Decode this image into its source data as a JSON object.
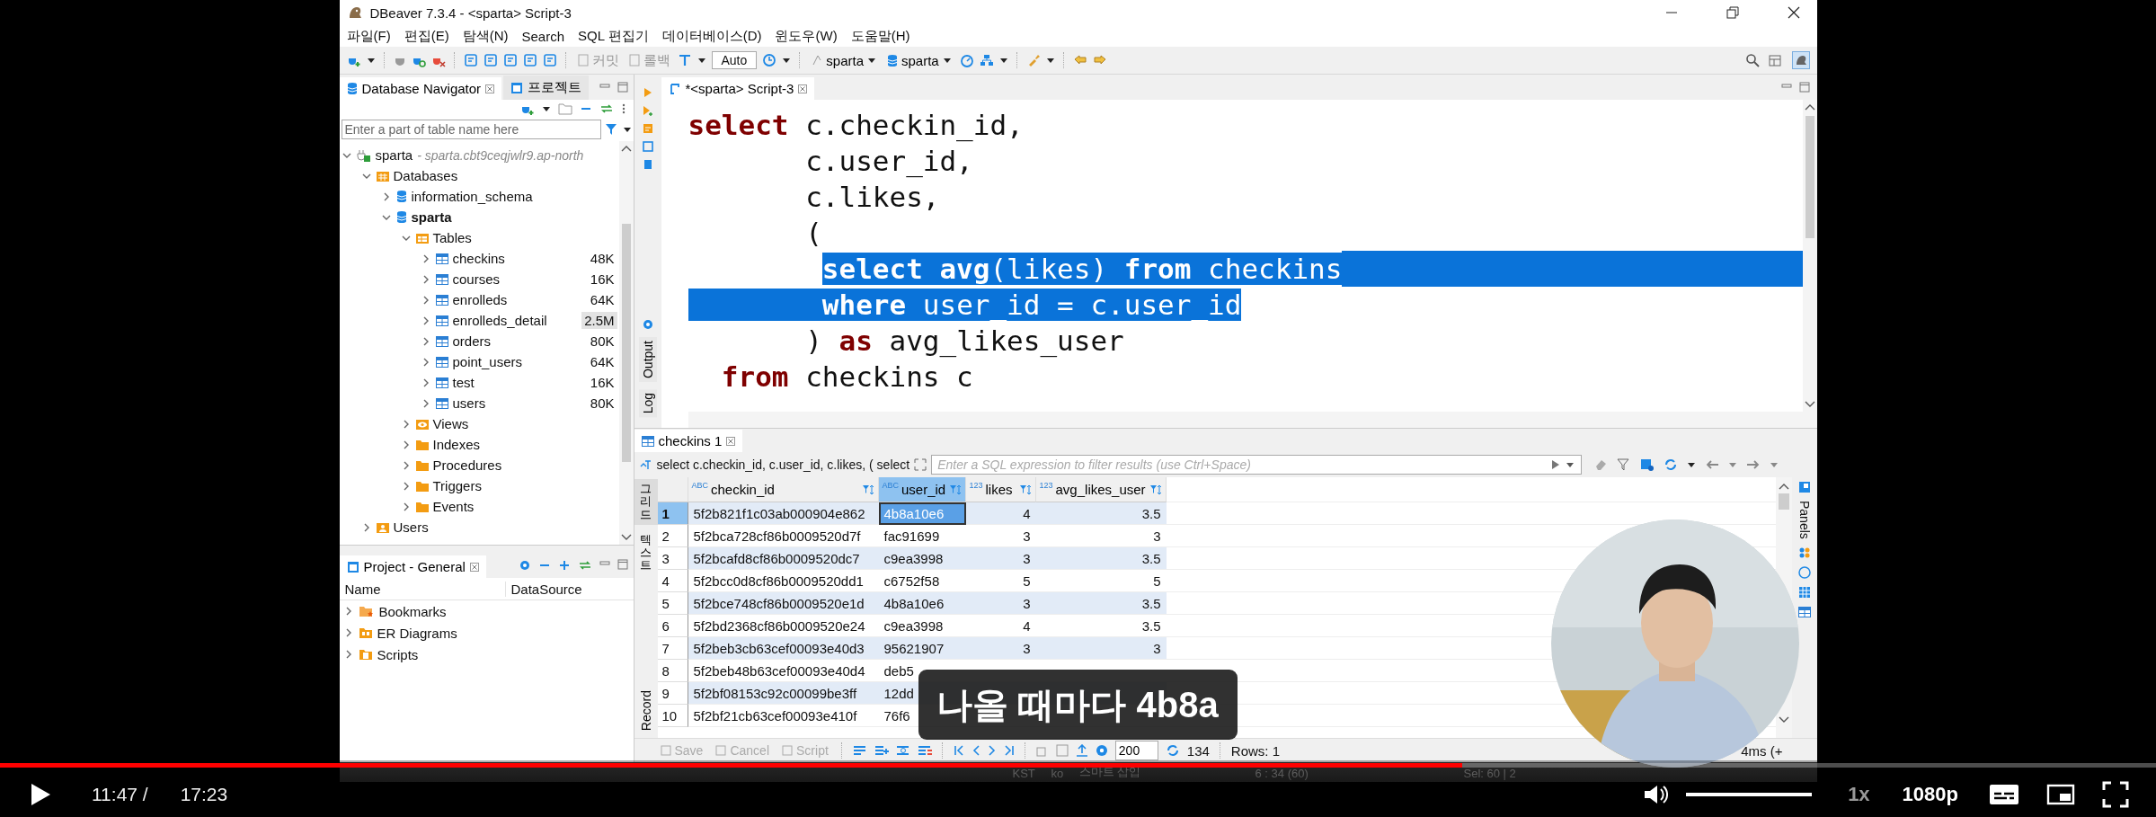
{
  "window": {
    "title": "DBeaver 7.3.4 - <sparta> Script-3"
  },
  "menu": [
    "파일(F)",
    "편집(E)",
    "탐색(N)",
    "Search",
    "SQL 편집기",
    "데이터베이스(D)",
    "윈도우(W)",
    "도움말(H)"
  ],
  "toolbar": {
    "commit": {
      "label": "커밋",
      "disabled": true
    },
    "rollback": {
      "label": "롤백",
      "disabled": true
    },
    "mode": "Auto",
    "datasource": "sparta",
    "schema": "sparta"
  },
  "navigator": {
    "tabs": [
      {
        "label": "Database Navigator",
        "selected": true
      },
      {
        "label": "프로젝트",
        "selected": false
      }
    ],
    "filter": {
      "placeholder": "Enter a part of table name here"
    },
    "tree": [
      {
        "label": "sparta",
        "detail": "- sparta.cbt9ceqjwlr9.ap-north",
        "kind": "connection",
        "expanded": true,
        "children": [
          {
            "label": "Databases",
            "kind": "databases",
            "expanded": true,
            "children": [
              {
                "label": "information_schema",
                "kind": "database",
                "expanded": false,
                "active": false
              },
              {
                "label": "sparta",
                "kind": "database",
                "expanded": true,
                "active": true,
                "children": [
                  {
                    "label": "Tables",
                    "kind": "tables",
                    "expanded": true,
                    "children": [
                      {
                        "label": "checkins",
                        "kind": "table",
                        "expanded": false,
                        "size": "48K",
                        "highlighted": false
                      },
                      {
                        "label": "courses",
                        "kind": "table",
                        "expanded": false,
                        "size": "16K",
                        "highlighted": false
                      },
                      {
                        "label": "enrolleds",
                        "kind": "table",
                        "expanded": false,
                        "size": "64K",
                        "highlighted": false
                      },
                      {
                        "label": "enrolleds_detail",
                        "kind": "table",
                        "expanded": false,
                        "size": "2.5M",
                        "highlighted": true
                      },
                      {
                        "label": "orders",
                        "kind": "table",
                        "expanded": false,
                        "size": "80K",
                        "highlighted": false
                      },
                      {
                        "label": "point_users",
                        "kind": "table",
                        "expanded": false,
                        "size": "64K",
                        "highlighted": false
                      },
                      {
                        "label": "test",
                        "kind": "table",
                        "expanded": false,
                        "size": "16K",
                        "highlighted": false
                      },
                      {
                        "label": "users",
                        "kind": "table",
                        "expanded": false,
                        "size": "80K",
                        "highlighted": false
                      }
                    ]
                  },
                  {
                    "label": "Views",
                    "kind": "views",
                    "expanded": false
                  },
                  {
                    "label": "Indexes",
                    "kind": "folder",
                    "expanded": false
                  },
                  {
                    "label": "Procedures",
                    "kind": "folder",
                    "expanded": false
                  },
                  {
                    "label": "Triggers",
                    "kind": "folder",
                    "expanded": false
                  },
                  {
                    "label": "Events",
                    "kind": "folder",
                    "expanded": false
                  }
                ]
              }
            ]
          },
          {
            "label": "Users",
            "kind": "users",
            "expanded": false
          }
        ]
      }
    ]
  },
  "project": {
    "tab": "Project - General",
    "columns": [
      "Name",
      "DataSource"
    ],
    "items": [
      {
        "label": "Bookmarks",
        "kind": "bookmarks",
        "expanded": false
      },
      {
        "label": "ER Diagrams",
        "kind": "diagrams",
        "expanded": false
      },
      {
        "label": "Scripts",
        "kind": "scripts",
        "expanded": false
      }
    ]
  },
  "side_tabs": [
    "Output",
    "Log"
  ],
  "editor": {
    "tab": "*<sparta> Script-3",
    "lines": [
      {
        "eol_selected": false,
        "tokens": [
          {
            "text": "select",
            "kind": "keyword",
            "selected": false
          },
          {
            "text": " c.checkin_id,",
            "kind": "plain",
            "selected": false
          }
        ]
      },
      {
        "eol_selected": false,
        "tokens": [
          {
            "text": "       c.user_id,",
            "kind": "plain",
            "selected": false
          }
        ]
      },
      {
        "eol_selected": false,
        "tokens": [
          {
            "text": "       c.likes,",
            "kind": "plain",
            "selected": false
          }
        ]
      },
      {
        "eol_selected": false,
        "tokens": [
          {
            "text": "       (",
            "kind": "plain",
            "selected": false
          }
        ]
      },
      {
        "eol_selected": true,
        "tokens": [
          {
            "text": "        select",
            "kind": "keyword",
            "selected": true
          },
          {
            "text": " avg",
            "kind": "function",
            "selected": true
          },
          {
            "text": "(likes) ",
            "kind": "plain",
            "selected": true
          },
          {
            "text": "from",
            "kind": "keyword",
            "selected": true
          },
          {
            "text": " checkins",
            "kind": "plain",
            "selected": true
          }
        ]
      },
      {
        "eol_selected": false,
        "tokens": [
          {
            "text": "        where",
            "kind": "keyword",
            "selected": true
          },
          {
            "text": " user_id = c.user_id",
            "kind": "plain",
            "selected": true
          }
        ]
      },
      {
        "eol_selected": false,
        "tokens": [
          {
            "text": "       ) ",
            "kind": "plain",
            "selected": false
          },
          {
            "text": "as",
            "kind": "keyword",
            "selected": false
          },
          {
            "text": " avg_likes_user",
            "kind": "plain",
            "selected": false
          }
        ]
      },
      {
        "eol_selected": false,
        "tokens": [
          {
            "text": "  from",
            "kind": "keyword",
            "selected": false
          },
          {
            "text": " checkins c",
            "kind": "plain",
            "selected": false
          }
        ]
      }
    ]
  },
  "results": {
    "tab": "checkins 1",
    "query": "select c.checkin_id, c.user_id, c.likes, ( select",
    "filter": {
      "placeholder": "Enter a SQL expression to filter results (use Ctrl+Space)"
    },
    "view_tabs": [
      {
        "label": "그리드",
        "selected": true
      },
      {
        "label": "텍스트",
        "selected": false
      },
      {
        "label": "Record",
        "selected": false
      }
    ],
    "columns": [
      {
        "label": "checkin_id",
        "type": "ABC",
        "selected": false
      },
      {
        "label": "user_id",
        "type": "ABC",
        "selected": true
      },
      {
        "label": "likes",
        "type": "123",
        "selected": false
      },
      {
        "label": "avg_likes_user",
        "type": "123",
        "selected": false
      }
    ],
    "rows": [
      {
        "number": "1",
        "selected": true,
        "cells": [
          "5f2b821f1c03ab000904e862",
          "4b8a10e6",
          "4",
          "3.5"
        ]
      },
      {
        "number": "2",
        "selected": false,
        "cells": [
          "5f2bca728cf86b0009520d7f",
          "fac91699",
          "3",
          "3"
        ]
      },
      {
        "number": "3",
        "selected": false,
        "cells": [
          "5f2bcafd8cf86b0009520dc7",
          "c9ea3998",
          "3",
          "3.5"
        ]
      },
      {
        "number": "4",
        "selected": false,
        "cells": [
          "5f2bcc0d8cf86b0009520dd1",
          "c6752f58",
          "5",
          "5"
        ]
      },
      {
        "number": "5",
        "selected": false,
        "cells": [
          "5f2bce748cf86b0009520e1d",
          "4b8a10e6",
          "3",
          "3.5"
        ]
      },
      {
        "number": "6",
        "selected": false,
        "cells": [
          "5f2bd2368cf86b0009520e24",
          "c9ea3998",
          "4",
          "3.5"
        ]
      },
      {
        "number": "7",
        "selected": false,
        "cells": [
          "5f2beb3cb63cef00093e40d3",
          "95621907",
          "3",
          "3"
        ]
      },
      {
        "number": "8",
        "selected": false,
        "cells": [
          "5f2beb48b63cef00093e40d4",
          "deb5",
          null,
          null
        ]
      },
      {
        "number": "9",
        "selected": false,
        "cells": [
          "5f2bf08153c92c00099be3ff",
          "12dd",
          null,
          null
        ]
      },
      {
        "number": "10",
        "selected": false,
        "cells": [
          "5f2bf21cb63cef00093e410f",
          "76f6",
          null,
          null
        ]
      }
    ],
    "side_panel": "Panels",
    "bottom": {
      "buttons": [
        {
          "label": "Save",
          "disabled": true
        },
        {
          "label": "Cancel",
          "disabled": true
        },
        {
          "label": "Script",
          "disabled": true
        }
      ],
      "fetch_size": "200",
      "count": "134",
      "rows_info": "Rows: 1",
      "timing": "4ms (+"
    }
  },
  "status_bar": [
    "KST",
    "ko",
    "스마트 삽입",
    "6 : 34 (60)",
    "Sel: 60 | 2"
  ],
  "subtitle": "나올 때마다 4b8a",
  "webcam": {
    "kind": "picture"
  },
  "player": {
    "progress": {
      "level": 0.678
    },
    "current": "11:47 /",
    "duration": "17:23",
    "volume": {
      "level": 1.0
    },
    "speed": "1x",
    "quality": "1080p"
  }
}
